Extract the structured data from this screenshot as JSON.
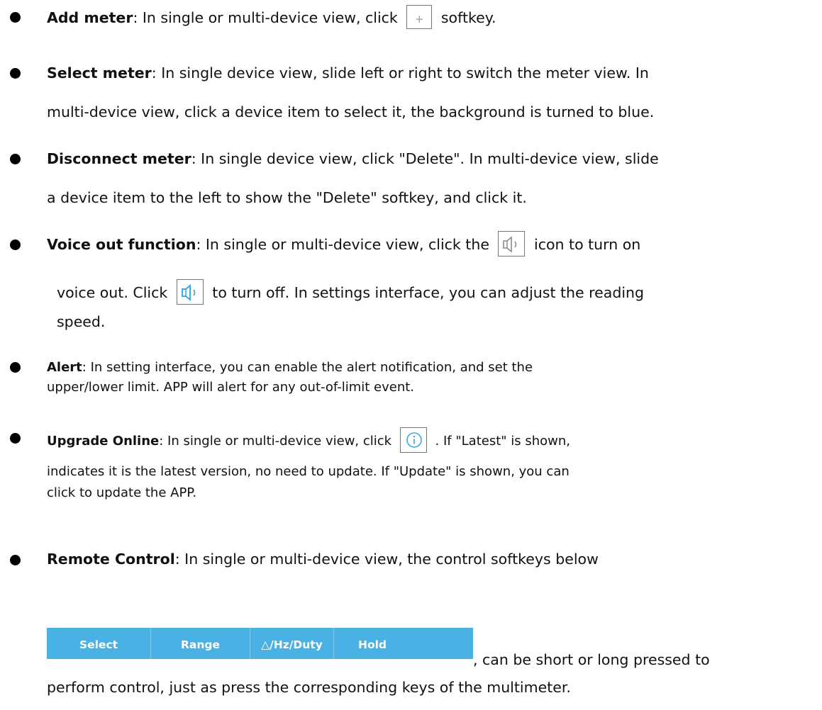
{
  "items": [
    {
      "term": "Add meter",
      "lines": [
        {
          "before": ": In single or multi-device view, click",
          "icon": "plus-icon",
          "after": "softkey."
        }
      ]
    },
    {
      "term": "Select meter",
      "lines": [
        ": In single device view, slide left or right to switch the meter view. In",
        "multi-device view, click a device item to select it, the background is turned to blue."
      ]
    },
    {
      "term": "Disconnect meter",
      "lines": [
        ": In single device view, click \"Delete\". In multi-device view, slide",
        "a device item to the left to show the \"Delete\" softkey, and click it."
      ]
    },
    {
      "term": "Voice out function",
      "lines": [
        {
          "before": ": In single or multi-device view, click the",
          "icon": "speaker-gray-icon",
          "after": "icon to turn on"
        },
        {
          "before": "voice out. Click",
          "icon": "speaker-blue-icon",
          "after": "to turn off. In settings interface, you can adjust the reading"
        },
        "speed."
      ]
    },
    {
      "term": "Alert",
      "lines": [
        ": In setting interface, you can enable the alert notification, and set the",
        "upper/lower limit. APP will alert for any out-of-limit event."
      ]
    },
    {
      "term": "Upgrade Online",
      "lines": [
        {
          "before": ": In single or multi-device view, click",
          "icon": "info-icon",
          "after": ". If \"Latest\" is shown,"
        },
        "indicates it is the latest version, no need to update. If \"Update\" is shown, you can",
        "click to update the APP."
      ]
    },
    {
      "term": "Remote Control",
      "lines": [
        ": In single or multi-device view, the control softkeys below",
        ", can be short or long pressed to",
        "perform control, just as press the corresponding keys of the multimeter."
      ]
    }
  ],
  "softkeys": [
    "Select",
    "Range",
    "△/Hz/Duty",
    "Hold"
  ],
  "colors": {
    "text": "#111111",
    "softkey_bg": "#4ab1e5",
    "softkey_text": "#ffffff",
    "speaker_gray": "#8a8a8a",
    "speaker_blue": "#3fa9e0",
    "info_blue": "#3fa9e0"
  }
}
